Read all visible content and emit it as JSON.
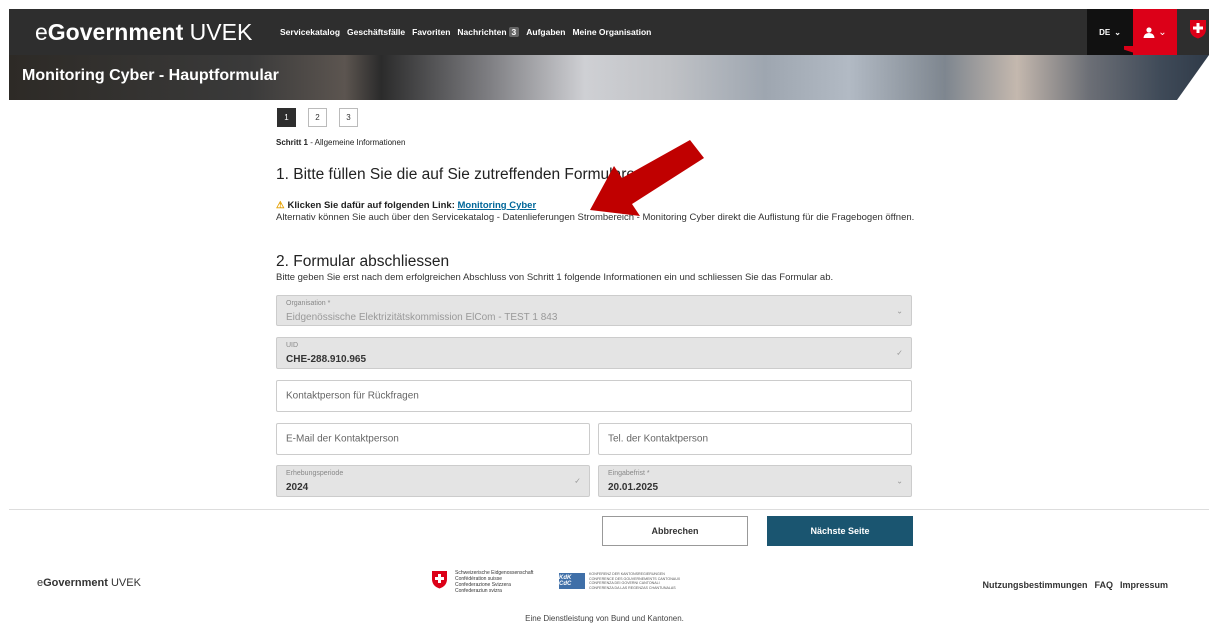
{
  "header": {
    "brand_prefix": "e",
    "brand_bold": "Government",
    "brand_suffix": " UVEK",
    "nav": [
      {
        "label": "Servicekatalog"
      },
      {
        "label": "Geschäftsfälle"
      },
      {
        "label": "Favoriten"
      },
      {
        "label": "Nachrichten",
        "badge": "3"
      },
      {
        "label": "Aufgaben"
      },
      {
        "label": "Meine Organisation"
      }
    ],
    "language": "DE",
    "colors": {
      "bar": "#2e2e2e",
      "accent_red": "#dc0018"
    }
  },
  "hero": {
    "title": "Monitoring Cyber - Hauptformular"
  },
  "stepper": {
    "steps": [
      "1",
      "2",
      "3"
    ],
    "active": 1,
    "current_label": "Schritt 1",
    "current_desc": " - Allgemeine Informationen"
  },
  "section1": {
    "heading": "1. Bitte füllen Sie die auf Sie zutreffenden Formulare aus",
    "warning_text": "Klicken Sie dafür auf folgenden Link: ",
    "link_text": "Monitoring Cyber",
    "alternative": "Alternativ können Sie auch über den Servicekatalog - Datenlieferungen Strombereich - Monitoring Cyber direkt die Auflistung für die Fragebogen öffnen."
  },
  "section2": {
    "heading": "2. Formular abschliessen",
    "subtitle": "Bitte geben Sie erst nach dem erfolgreichen Abschluss von Schritt 1 folgende Informationen ein und schliessen Sie das Formular ab."
  },
  "fields": {
    "organisation": {
      "label": "Organisation *",
      "value": "Eidgenössische Elektrizitätskommission ElCom - TEST 1 843"
    },
    "uid": {
      "label": "UID",
      "value": "CHE-288.910.965"
    },
    "contact": {
      "placeholder": "Kontaktperson für Rückfragen"
    },
    "email": {
      "placeholder": "E-Mail der Kontaktperson"
    },
    "phone": {
      "placeholder": "Tel. der Kontaktperson"
    },
    "period": {
      "label": "Erhebungsperiode",
      "value": "2024"
    },
    "deadline": {
      "label": "Eingabefrist *",
      "value": "20.01.2025"
    }
  },
  "actions": {
    "cancel": "Abbrechen",
    "next": "Nächste Seite"
  },
  "footer": {
    "brand_bold": "Government",
    "brand_prefix": "e",
    "brand_suffix": " UVEK",
    "confederation": [
      "Schweizerische Eidgenossenschaft",
      "Confédération suisse",
      "Confederazione Svizzera",
      "Confederaziun svizra"
    ],
    "kdk_logo": "KdK CdC",
    "kdk_lines": [
      "KONFERENZ DER KANTONSREGIERUNGEN",
      "CONFERENCE DES GOUVERNEMENTS CANTONAUX",
      "CONFERENZA DEI GOVERNI CANTONALI",
      "CONFERENZA DA LAS REGENZAS CHANTUNALAS"
    ],
    "links": [
      "Nutzungsbestimmungen",
      "FAQ",
      "Impressum"
    ],
    "service_note": "Eine Dienstleistung von Bund und Kantonen."
  }
}
